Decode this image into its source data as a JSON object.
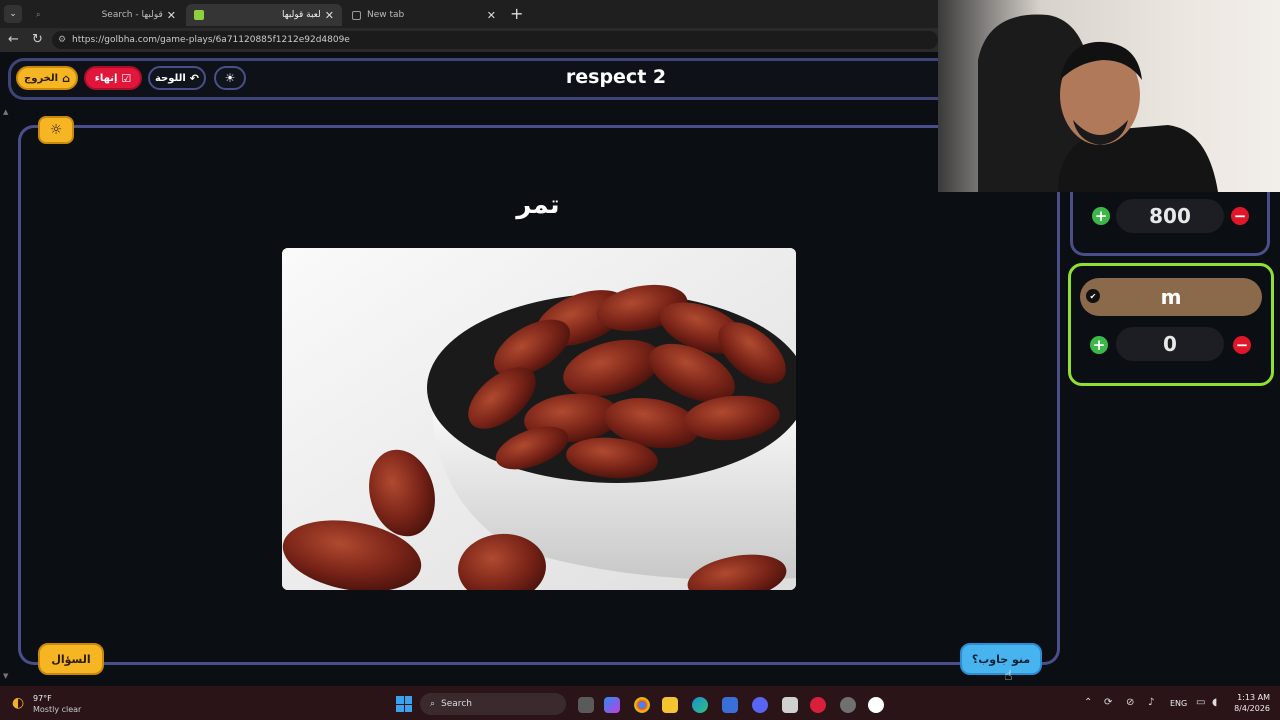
{
  "browser": {
    "tabs": [
      {
        "label": "Search - قولبها",
        "active": false
      },
      {
        "label": "لعبة قولبها",
        "active": true
      },
      {
        "label": "New tab",
        "active": false
      }
    ],
    "url": "https://golbha.com/game-plays/6a71120885f1212e92d4809e",
    "new_tab_icon": "+",
    "close_icon": "✕"
  },
  "header": {
    "title": "respect 2",
    "exit_label": "الخروج",
    "end_label": "إنهاء",
    "board_label": "اللوحة",
    "theme_icon": "☀"
  },
  "main": {
    "answer_word": "تمر",
    "image_alt": "bowl of dates",
    "question_button": "السؤال",
    "who_answered_button": "منو جاوب؟",
    "bug_icon": "☼"
  },
  "teams": [
    {
      "name": "",
      "score": "800"
    },
    {
      "name": "m",
      "score": "0",
      "active": true
    }
  ],
  "controls": {
    "plus": "+",
    "minus": "−"
  },
  "taskbar": {
    "weather_temp": "97°F",
    "weather_desc": "Mostly clear",
    "search_label": "Search",
    "lang": "ENG",
    "time": "1:13 AM",
    "date": "8/4/2026"
  },
  "colors": {
    "accent_yellow": "#f6b624",
    "accent_red": "#e0163a",
    "accent_blue": "#47b4f0",
    "panel_border": "#4a4f8a",
    "active_team_border": "#8fe030"
  }
}
